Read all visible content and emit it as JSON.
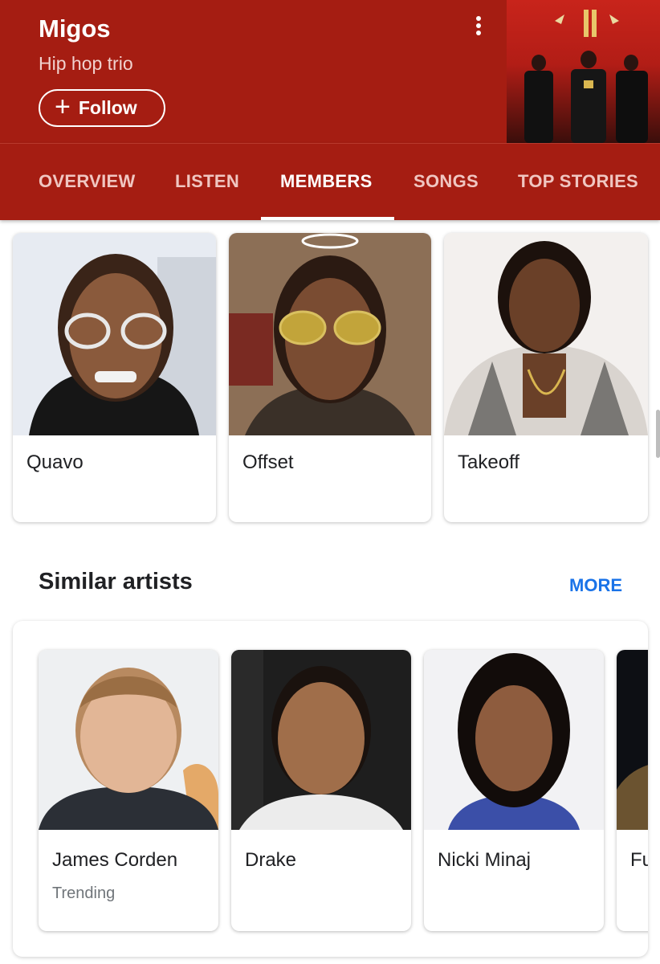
{
  "header": {
    "title": "Migos",
    "subtitle": "Hip hop trio",
    "follow_label": "Follow",
    "follow_icon": "plus-icon",
    "menu_icon": "more-vert-icon",
    "accent_color": "#a51d12"
  },
  "tabs": [
    {
      "label": "OVERVIEW",
      "active": false
    },
    {
      "label": "LISTEN",
      "active": false
    },
    {
      "label": "MEMBERS",
      "active": true
    },
    {
      "label": "SONGS",
      "active": false
    },
    {
      "label": "TOP STORIES",
      "active": false
    }
  ],
  "members": [
    {
      "name": "Quavo"
    },
    {
      "name": "Offset"
    },
    {
      "name": "Takeoff"
    }
  ],
  "similar": {
    "title": "Similar artists",
    "more_label": "MORE",
    "more_color": "#1a73e8",
    "artists": [
      {
        "name": "James Corden",
        "sub": "Trending"
      },
      {
        "name": "Drake",
        "sub": ""
      },
      {
        "name": "Nicki Minaj",
        "sub": ""
      },
      {
        "name": "Fut",
        "sub": ""
      }
    ]
  }
}
